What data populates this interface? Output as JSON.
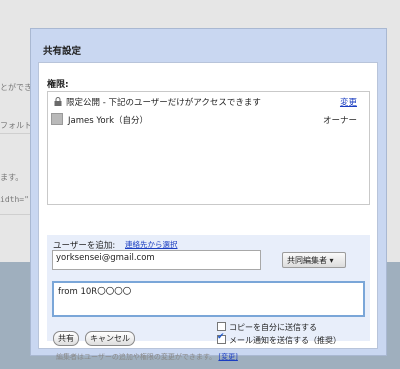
{
  "background": {
    "lines": [
      "とができ",
      "フォルト)",
      "ます。",
      "idth=\""
    ]
  },
  "dialog": {
    "title": "共有設定",
    "permissions_label": "権限:",
    "permission": {
      "text": "限定公開 - 下記のユーザーだけがアクセスできます",
      "change_link": "変更"
    },
    "owner": {
      "name": "James York（自分）",
      "role": "オーナー"
    },
    "add_users": {
      "label": "ユーザーを追加:",
      "contacts_link": "連絡先から選択",
      "email_value": "yorksensei@gmail.com",
      "role_select": "共同編集者 ▾",
      "message_value": "from 10R〇〇〇〇"
    },
    "options": {
      "copy_self": "コピーを自分に送信する",
      "notify": "メール通知を送信する（推奨）",
      "notify_checked": true,
      "copy_checked": false
    },
    "buttons": {
      "share": "共有",
      "cancel": "キャンセル"
    },
    "footer": {
      "note": "編集者はユーザーの追加や権限の変更ができます。",
      "link": "[変更]"
    }
  }
}
